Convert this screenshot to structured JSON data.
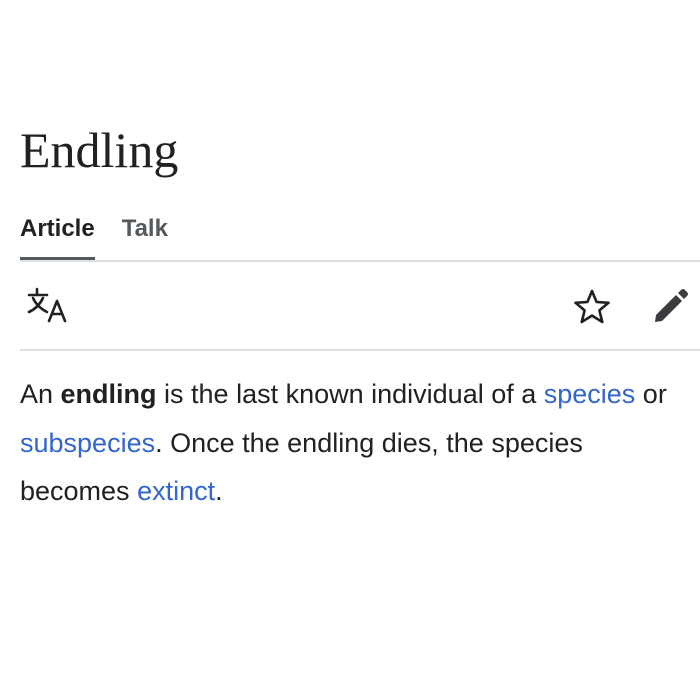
{
  "page": {
    "title": "Endling"
  },
  "tabs": [
    {
      "label": "Article",
      "active": true
    },
    {
      "label": "Talk",
      "active": false
    }
  ],
  "toolbar": {
    "translate_icon": "language-translate-icon",
    "watch_icon": "star-outline-icon",
    "edit_icon": "pencil-icon"
  },
  "content": {
    "p1": "An ",
    "bold": "endling",
    "p2": " is the last known individual of a ",
    "link1": "species",
    "p3": " or ",
    "link2": "subspecies",
    "p4": ". Once the endling dies, the species becomes ",
    "link3": "extinct",
    "p5": "."
  },
  "colors": {
    "text": "#202122",
    "link": "#3366cc",
    "tab_inactive": "#54595d",
    "divider": "#dcdfe3"
  }
}
